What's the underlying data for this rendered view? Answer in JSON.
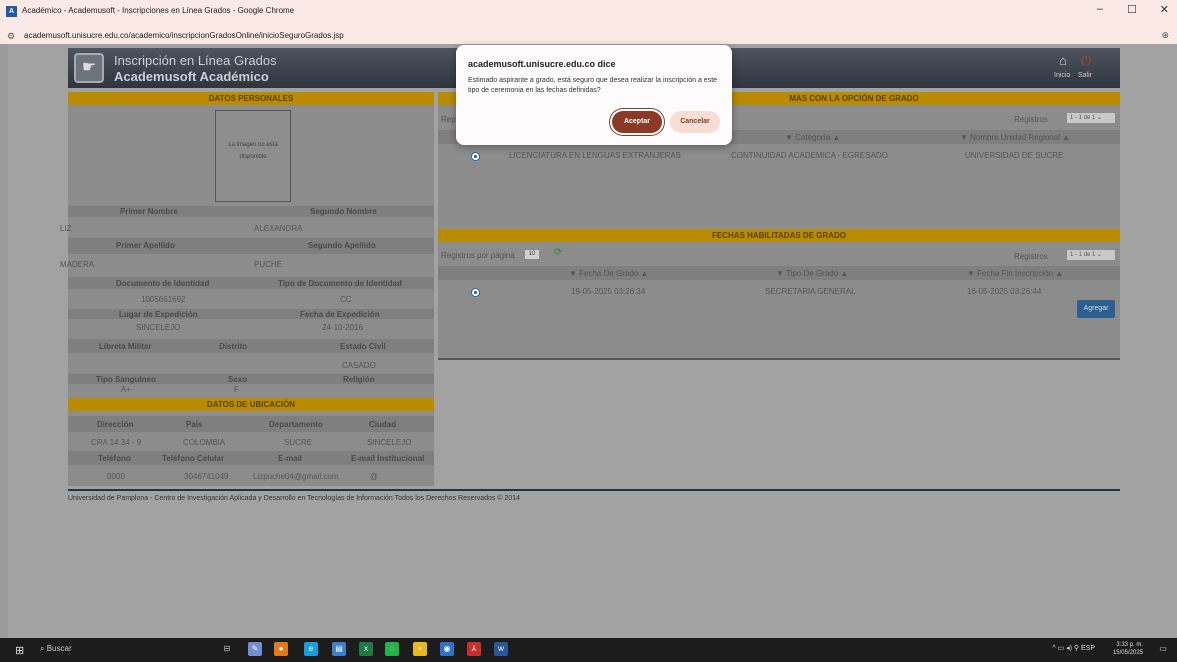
{
  "window": {
    "title": "Académico - Academusoft - Inscripciones en Línea Grados - Google Chrome",
    "minimize": "–",
    "maximize": "☐",
    "close": "✕"
  },
  "browser": {
    "url": "academusoft.unisucre.edu.co/academico/inscripcionGradosOnline/inicioSeguroGrados.jsp",
    "zoom_icon": "zoom-icon"
  },
  "banner": {
    "title": "Inscripción en Línea Grados",
    "subtitle": "Academusoft Académico",
    "inicio": "Inicio",
    "salir": "Salir"
  },
  "personal": {
    "header": "DATOS PERSONALES",
    "photo_text": "La imagen no está disponible",
    "primer_nombre_label": "Primer Nombre",
    "segundo_nombre_label": "Segundo Nombre",
    "primer_nombre": "LIZ",
    "segundo_nombre": "ALEXANDRA",
    "primer_apellido_label": "Primer Apellido",
    "segundo_apellido_label": "Segundo Apellido",
    "primer_apellido": "MADERA",
    "segundo_apellido": "PUCHE",
    "documento_label": "Documento de Identidad",
    "tipo_doc_label": "Tipo de Documento de Identidad",
    "documento": "1005661692",
    "tipo_doc": "CC",
    "lugar_exp_label": "Lugar de Expedición",
    "fecha_exp_label": "Fecha de Expedición",
    "lugar_exp": "SINCELEJO",
    "fecha_exp": "24-10-2016",
    "libreta_label": "Libreta Militar",
    "distrito_label": "Distrito",
    "estado_civil_label": "Estado Civil",
    "estado_civil": "CASADO",
    "tipo_sangre_label": "Tipo Sanguineo",
    "sexo_label": "Sexo",
    "religion_label": "Religión",
    "tipo_sangre": "A+",
    "sexo": "F"
  },
  "ubicacion": {
    "header": "DATOS DE UBICACIÓN",
    "direccion_label": "Dirección",
    "pais_label": "Pais",
    "departamento_label": "Departamento",
    "ciudad_label": "Ciudad",
    "direccion": "CRA 14 34 - 9",
    "pais": "COLOMBIA",
    "departamento": "SUCRE",
    "ciudad": "SINCELEJO",
    "telefono_label": "Teléfono",
    "celular_label": "Teléfono Celular",
    "email_label": "E-mail",
    "email_inst_label": "E-mail Institucional",
    "telefono": "0000",
    "celular": "3046741049",
    "email": "Lizpuche04@gmail.com",
    "email_inst": "@"
  },
  "programas": {
    "header": "MAS CON LA OPCIÓN DE GRADO",
    "rep_prefix": "Rep",
    "registros_label": "Registros",
    "registros_range": "1 - 1 de 1",
    "col_categoria": "▼ Categoría ▲",
    "col_unidad": "▼ Nombre Unidad Regional ▲",
    "row": {
      "programa": "LICENCIATURA EN LENGUAS EXTRANJERAS",
      "categoria": "CONTINUIDAD ACADEMICA - EGRESADO",
      "unidad": "UNIVERSIDAD DE SUCRE"
    }
  },
  "fechas": {
    "header": "FECHAS HABILITADAS DE GRADO",
    "registros_pagina_label": "Registros por página",
    "registros_pagina": "10",
    "registros_label": "Registros",
    "registros_range": "1 - 1 de 1",
    "col_fecha": "▼ Fecha De Grado ▲",
    "col_tipo": "▼ Tipo De Grado ▲",
    "col_fin": "▼ Fecha Fin Inscripción ▲",
    "row": {
      "fecha": "19-05-2025 03:26:34",
      "tipo": "SECRETARIA GENERAL",
      "fin": "16-05-2025 03:26:44"
    },
    "agregar": "Agregar"
  },
  "footer": "Universidad de Pamplona - Centro de Investigación Aplicada y Desarrollo en Tecnologías de Información Todos los Derechos Reservados © 2014",
  "dialog": {
    "title": "academusoft.unisucre.edu.co dice",
    "message": "Estimado aspirante a grado, está seguro que desea realizar la inscripción a este tipo de ceremonia en las fechas definidas?",
    "accept": "Aceptar",
    "cancel": "Cancelar"
  },
  "taskbar": {
    "search": "Buscar",
    "lang": "ESP",
    "time": "3:33 p. m.",
    "date": "15/05/2025"
  }
}
